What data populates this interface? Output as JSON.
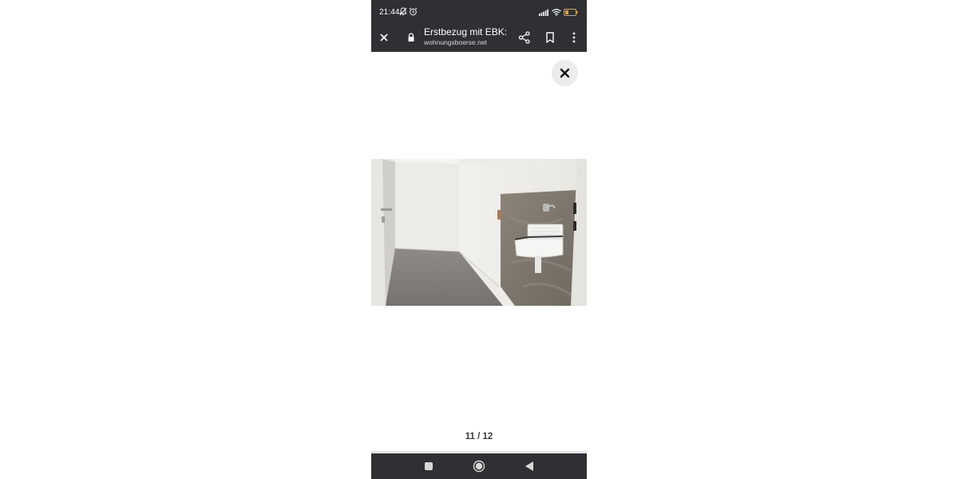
{
  "status_bar": {
    "time": "21:44",
    "left_icons": [
      "bell-off-icon",
      "alarm-icon"
    ],
    "right_icons": [
      "signal-icon",
      "wifi-icon",
      "battery-icon"
    ],
    "battery_level": "16"
  },
  "toolbar": {
    "title": "Erstbezug mit EBK:...",
    "url": "wohnungsboerse.net",
    "icons": [
      "close-icon",
      "lock-icon",
      "share-icon",
      "bookmark-icon",
      "more-vert-icon"
    ]
  },
  "viewer": {
    "close_icon": "close-icon",
    "image_subject": "utility room with wall sink",
    "counter": "11 / 12"
  },
  "nav_bar": {
    "icons": [
      "recents-square-icon",
      "home-circle-icon",
      "back-triangle-icon"
    ]
  },
  "colors": {
    "bar_background": "#2e3033",
    "close_button_bg": "#ececec",
    "battery": "#f0a030"
  }
}
